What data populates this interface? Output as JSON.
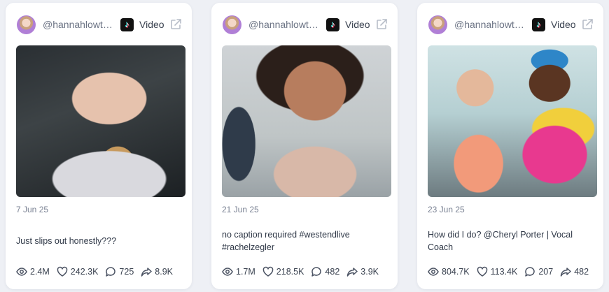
{
  "posts": [
    {
      "handle": "@hannahlowth...",
      "type_label": "Video",
      "date": "7 Jun 25",
      "caption": "Just slips out honestly???",
      "stats": {
        "views": "2.4M",
        "likes": "242.3K",
        "comments": "725",
        "shares": "8.9K"
      }
    },
    {
      "handle": "@hannahlowth...",
      "type_label": "Video",
      "date": "21 Jun 25",
      "caption": "no caption required #westendlive #rachelzegler",
      "stats": {
        "views": "1.7M",
        "likes": "218.5K",
        "comments": "482",
        "shares": "3.9K"
      }
    },
    {
      "handle": "@hannahlowth...",
      "type_label": "Video",
      "date": "23 Jun 25",
      "caption": "How did I do? @Cheryl Porter | Vocal Coach",
      "stats": {
        "views": "804.7K",
        "likes": "113.4K",
        "comments": "207",
        "shares": "482"
      }
    }
  ],
  "icons": {
    "platform": "tiktok-icon",
    "external": "external-link-icon",
    "views": "eye-icon",
    "likes": "heart-icon",
    "comments": "comment-icon",
    "shares": "share-icon"
  },
  "colors": {
    "icon_stroke": "#4a5262",
    "muted_text": "#7b8394",
    "background": "#eef0f5"
  }
}
